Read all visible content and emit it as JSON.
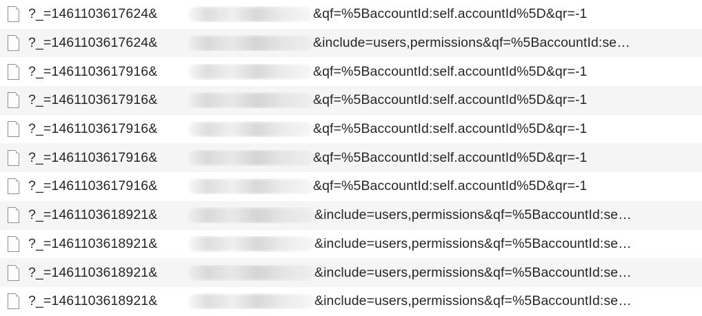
{
  "requests": [
    {
      "prefix": "?_=1461103617624&",
      "redacted": "short",
      "suffix": "&qf=%5BaccountId:self.accountId%5D&qr=-1"
    },
    {
      "prefix": "?_=1461103617624&",
      "redacted": "short",
      "suffix": "&include=users,permissions&qf=%5BaccountId:se…"
    },
    {
      "prefix": "?_=1461103617916&",
      "redacted": "short",
      "suffix": "&qf=%5BaccountId:self.accountId%5D&qr=-1"
    },
    {
      "prefix": "?_=1461103617916&",
      "redacted": "short",
      "suffix": "&qf=%5BaccountId:self.accountId%5D&qr=-1"
    },
    {
      "prefix": "?_=1461103617916&",
      "redacted": "short",
      "suffix": "&qf=%5BaccountId:self.accountId%5D&qr=-1"
    },
    {
      "prefix": "?_=1461103617916&",
      "redacted": "short",
      "suffix": "&qf=%5BaccountId:self.accountId%5D&qr=-1"
    },
    {
      "prefix": "?_=1461103617916&",
      "redacted": "short",
      "suffix": "&qf=%5BaccountId:self.accountId%5D&qr=-1"
    },
    {
      "prefix": "?_=1461103618921&",
      "redacted": "long",
      "suffix": "&include=users,permissions&qf=%5BaccountId:se…"
    },
    {
      "prefix": "?_=1461103618921&",
      "redacted": "long",
      "suffix": "&include=users,permissions&qf=%5BaccountId:se…"
    },
    {
      "prefix": "?_=1461103618921&",
      "redacted": "long",
      "suffix": "&include=users,permissions&qf=%5BaccountId:se…"
    },
    {
      "prefix": "?_=1461103618921&",
      "redacted": "long",
      "suffix": "&include=users,permissions&qf=%5BaccountId:se…"
    }
  ],
  "icons": {
    "row_icon": "document-icon"
  },
  "colors": {
    "row_odd": "#f5f5f5",
    "row_even": "#ffffff",
    "text": "#262626"
  }
}
